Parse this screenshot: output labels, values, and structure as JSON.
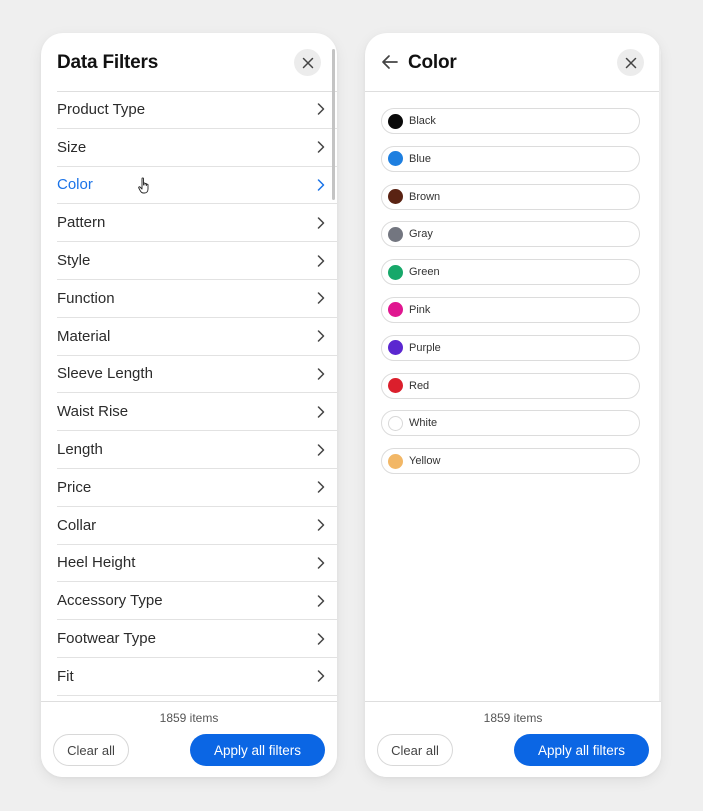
{
  "left_panel": {
    "title": "Data Filters",
    "close_icon": "close-icon",
    "filters": [
      {
        "label": "Product Type",
        "active": false
      },
      {
        "label": "Size",
        "active": false
      },
      {
        "label": "Color",
        "active": true
      },
      {
        "label": "Pattern",
        "active": false
      },
      {
        "label": "Style",
        "active": false
      },
      {
        "label": "Function",
        "active": false
      },
      {
        "label": "Material",
        "active": false
      },
      {
        "label": "Sleeve Length",
        "active": false
      },
      {
        "label": "Waist Rise",
        "active": false
      },
      {
        "label": "Length",
        "active": false
      },
      {
        "label": "Price",
        "active": false
      },
      {
        "label": "Collar",
        "active": false
      },
      {
        "label": "Heel Height",
        "active": false
      },
      {
        "label": "Accessory Type",
        "active": false
      },
      {
        "label": "Footwear Type",
        "active": false
      },
      {
        "label": "Fit",
        "active": false
      }
    ],
    "footer": {
      "count": "1859 items",
      "clear_label": "Clear all",
      "apply_label": "Apply all filters"
    }
  },
  "right_panel": {
    "title": "Color",
    "back_icon": "arrow-left-icon",
    "close_icon": "close-icon",
    "colors": [
      {
        "label": "Black",
        "hex": "#0a0a0a"
      },
      {
        "label": "Blue",
        "hex": "#1e7fe0"
      },
      {
        "label": "Brown",
        "hex": "#5a2313"
      },
      {
        "label": "Gray",
        "hex": "#737680"
      },
      {
        "label": "Green",
        "hex": "#17a86a"
      },
      {
        "label": "Pink",
        "hex": "#e01690"
      },
      {
        "label": "Purple",
        "hex": "#5b27d0"
      },
      {
        "label": "Red",
        "hex": "#db1f2c"
      },
      {
        "label": "White",
        "hex": "#ffffff"
      },
      {
        "label": "Yellow",
        "hex": "#f2b766"
      }
    ],
    "footer": {
      "count": "1859 items",
      "clear_label": "Clear all",
      "apply_label": "Apply all filters"
    }
  },
  "theme": {
    "accent": "#0b66e4",
    "active_text": "#1a73e8"
  }
}
